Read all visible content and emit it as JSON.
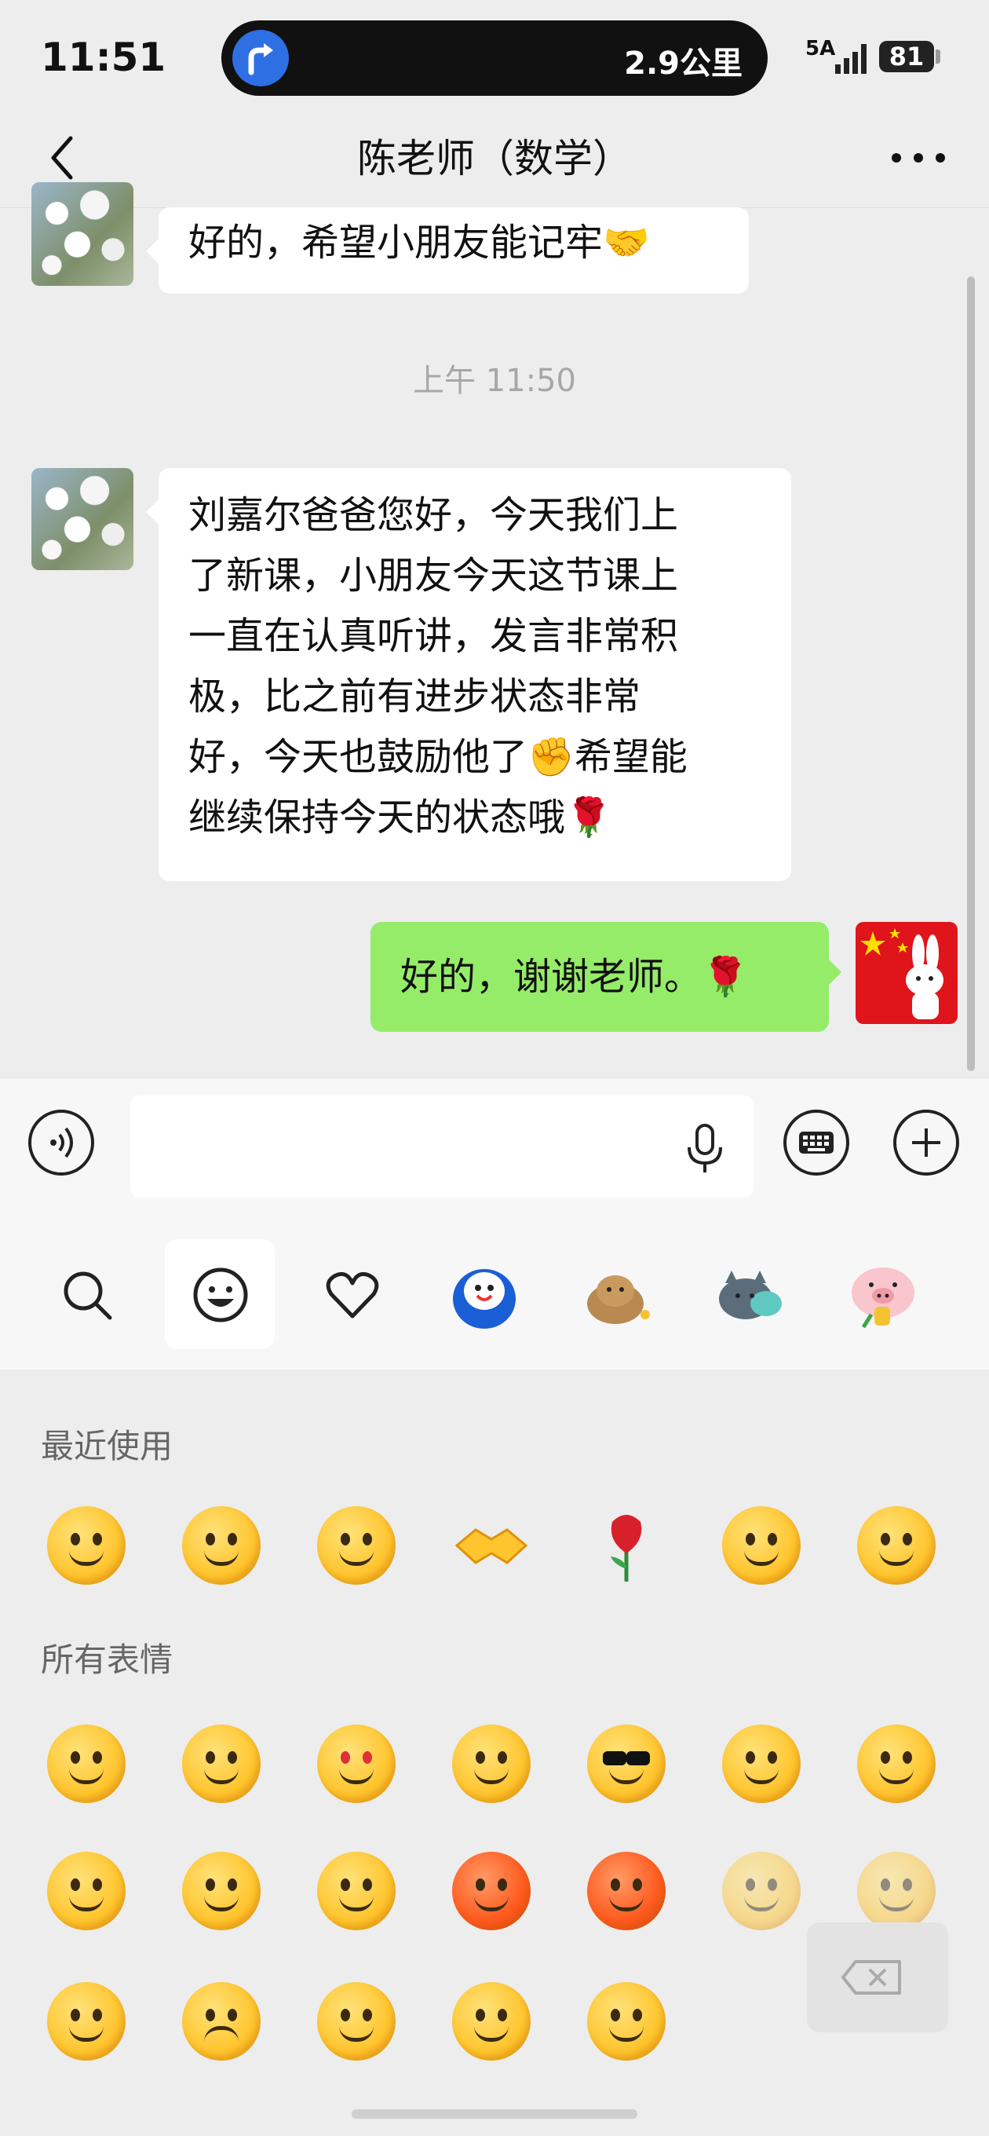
{
  "status_bar": {
    "time": "11:51",
    "nav_distance": "2.9公里",
    "network": "5A",
    "battery": "81"
  },
  "header": {
    "title": "陈老师（数学）"
  },
  "chat": {
    "messages": [
      {
        "side": "left",
        "text": "好的，希望小朋友能记牢🤝"
      },
      {
        "type": "time",
        "text": "上午 11:50"
      },
      {
        "side": "left",
        "lines": [
          "刘嘉尔爸爸您好，今天我们上",
          "了新课，小朋友今天这节课上",
          "一直在认真听讲，发言非常积",
          "极，比之前有进步状态非常",
          "好，今天也鼓励他了✊希望能",
          "继续保持今天的状态哦🌹"
        ]
      },
      {
        "side": "right",
        "text": "好的，谢谢老师。🌹"
      }
    ]
  },
  "input": {
    "value": "",
    "placeholder": ""
  },
  "emoji_tabs": [
    "search-icon",
    "emoji-face-icon",
    "heart-icon",
    "sticker-blue-character",
    "sticker-cat-photo",
    "sticker-cat",
    "sticker-pig"
  ],
  "panel": {
    "recent_title": "最近使用",
    "all_title": "所有表情",
    "recent": [
      "facepalm",
      "tears-of-joy",
      "grin",
      "handshake",
      "rose",
      "smile",
      "laugh"
    ],
    "all_rows": [
      [
        "smile",
        "awkward",
        "heart-eyes",
        "stare",
        "cool",
        "crying",
        "shy"
      ],
      [
        "shut-mouth",
        "sleepy",
        "tearful",
        "embarrassed",
        "angry",
        "tongue-wink",
        "grin"
      ],
      [
        "surprised",
        "frown",
        "blush",
        "scream",
        "drool"
      ]
    ]
  }
}
